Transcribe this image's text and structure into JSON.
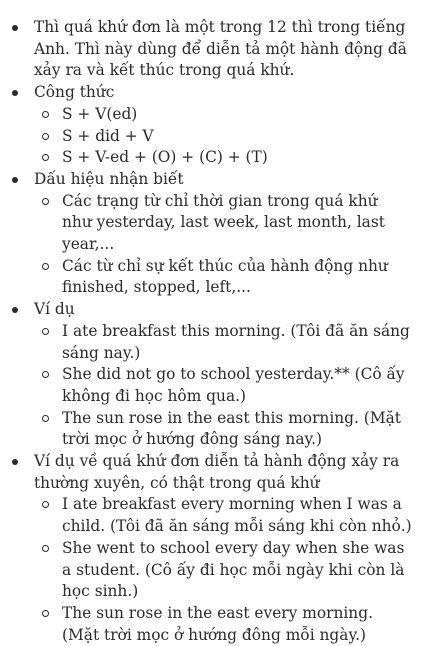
{
  "items": [
    {
      "text": "Thì quá khứ đơn là một trong 12 thì trong tiếng Anh. Thì này dùng để diễn tả một hành động đã xảy ra và kết thúc trong quá khứ.",
      "sub": []
    },
    {
      "text": "Công thức",
      "sub": [
        "S + V(ed)",
        "S + did + V",
        "S + V-ed + (O) + (C) + (T)"
      ]
    },
    {
      "text": "Dấu hiệu nhận biết",
      "sub": [
        "Các trạng từ chỉ thời gian trong quá khứ như yesterday, last week, last month, last year,...",
        "Các từ chỉ sự kết thúc của hành động như finished, stopped, left,..."
      ]
    },
    {
      "text": "Ví dụ",
      "sub": [
        "I ate breakfast this morning. (Tôi đã ăn sáng sáng nay.)",
        "She did not go to school yesterday.** (Cô ấy không đi học hôm qua.)",
        "The sun rose in the east this morning. (Mặt trời mọc ở hướng đông sáng nay.)"
      ]
    },
    {
      "text": "Ví dụ về quá khứ đơn diễn tả hành động xảy ra thường xuyên, có thật trong quá khứ",
      "sub": [
        "I ate breakfast every morning when I was a child. (Tôi đã ăn sáng mỗi sáng khi còn nhỏ.)",
        "She went to school every day when she was a student. (Cô ấy đi học mỗi ngày khi còn là học sinh.)",
        "The sun rose in the east every morning. (Mặt trời mọc ở hướng đông mỗi ngày.)"
      ]
    }
  ]
}
